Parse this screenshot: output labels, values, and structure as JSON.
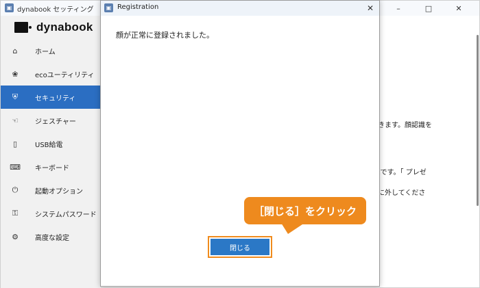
{
  "app": {
    "title": "dynabook セッティング",
    "logo_text": "dynabook",
    "window_controls": {
      "minimize": "–",
      "maximize": "□",
      "close": "✕"
    }
  },
  "sidebar": {
    "items": [
      {
        "label": "ホーム",
        "icon": "home-icon",
        "glyph": "⌂"
      },
      {
        "label": "ecoユーティリティ",
        "icon": "eco-icon",
        "glyph": "❀"
      },
      {
        "label": "セキュリティ",
        "icon": "shield-icon",
        "glyph": "⛨"
      },
      {
        "label": "ジェスチャー",
        "icon": "gesture-icon",
        "glyph": "☜"
      },
      {
        "label": "USB給電",
        "icon": "usb-icon",
        "glyph": "▯"
      },
      {
        "label": "キーボード",
        "icon": "keyboard-icon",
        "glyph": "⌨"
      },
      {
        "label": "起動オプション",
        "icon": "power-icon",
        "glyph": "⏻"
      },
      {
        "label": "システムパスワード",
        "icon": "key-icon",
        "glyph": "⚿"
      },
      {
        "label": "高度な設定",
        "icon": "gear-icon",
        "glyph": "⚙"
      }
    ],
    "active_index": 2
  },
  "content": {
    "line1": "できます。顔認識を",
    "line2": "f能です。「 プレゼ",
    "line3": "前に外してくださ"
  },
  "dialog": {
    "title": "Registration",
    "close_glyph": "✕",
    "message": "顔が正常に登録されました。",
    "close_button_label": "閉じる"
  },
  "callout": {
    "text": "［閉じる］をクリック"
  },
  "colors": {
    "accent": "#2b6ec2",
    "button": "#2b78c6",
    "callout": "#ee8a1e",
    "highlight_border": "#f08b1e"
  }
}
